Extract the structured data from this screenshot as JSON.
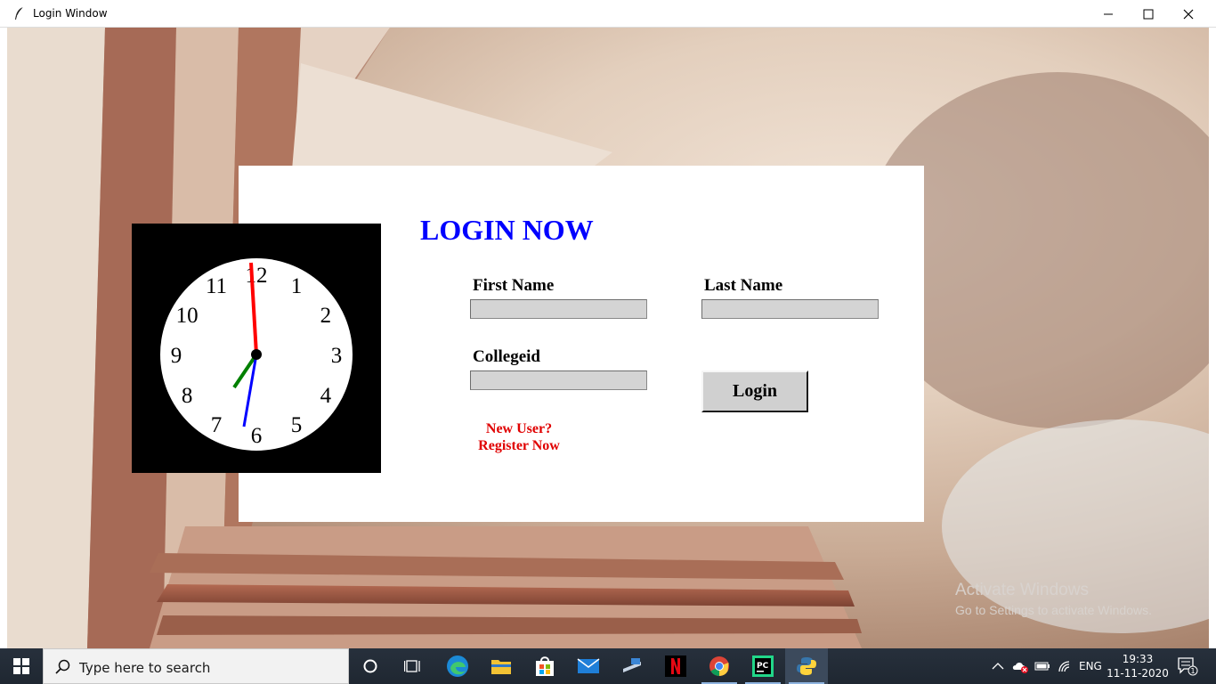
{
  "window": {
    "title": "Login Window"
  },
  "login": {
    "heading": "LOGIN NOW",
    "first_name_label": "First Name",
    "first_name_value": "",
    "last_name_label": "Last Name",
    "last_name_value": "",
    "collegeid_label": "Collegeid",
    "collegeid_value": "",
    "login_button": "Login",
    "new_user_line1": "New User?",
    "new_user_line2": "Register Now"
  },
  "clock": {
    "numerals": [
      "12",
      "1",
      "2",
      "3",
      "4",
      "5",
      "6",
      "7",
      "8",
      "9",
      "10",
      "11"
    ],
    "hour_hand_color": "#008000",
    "minute_hand_color": "#ff0000",
    "second_hand_color": "#0000ff"
  },
  "watermark": {
    "line1": "Activate Windows",
    "line2": "Go to Settings to activate Windows."
  },
  "taskbar": {
    "search_placeholder": "Type here to search",
    "apps": [
      "cortana-icon",
      "task-view-icon",
      "edge-icon",
      "file-explorer-icon",
      "store-icon",
      "mail-icon",
      "network-app-icon",
      "netflix-icon",
      "chrome-icon",
      "pycharm-icon",
      "python-icon"
    ],
    "language": "ENG",
    "time": "19:33",
    "date": "11-11-2020",
    "notification_count": "1"
  }
}
